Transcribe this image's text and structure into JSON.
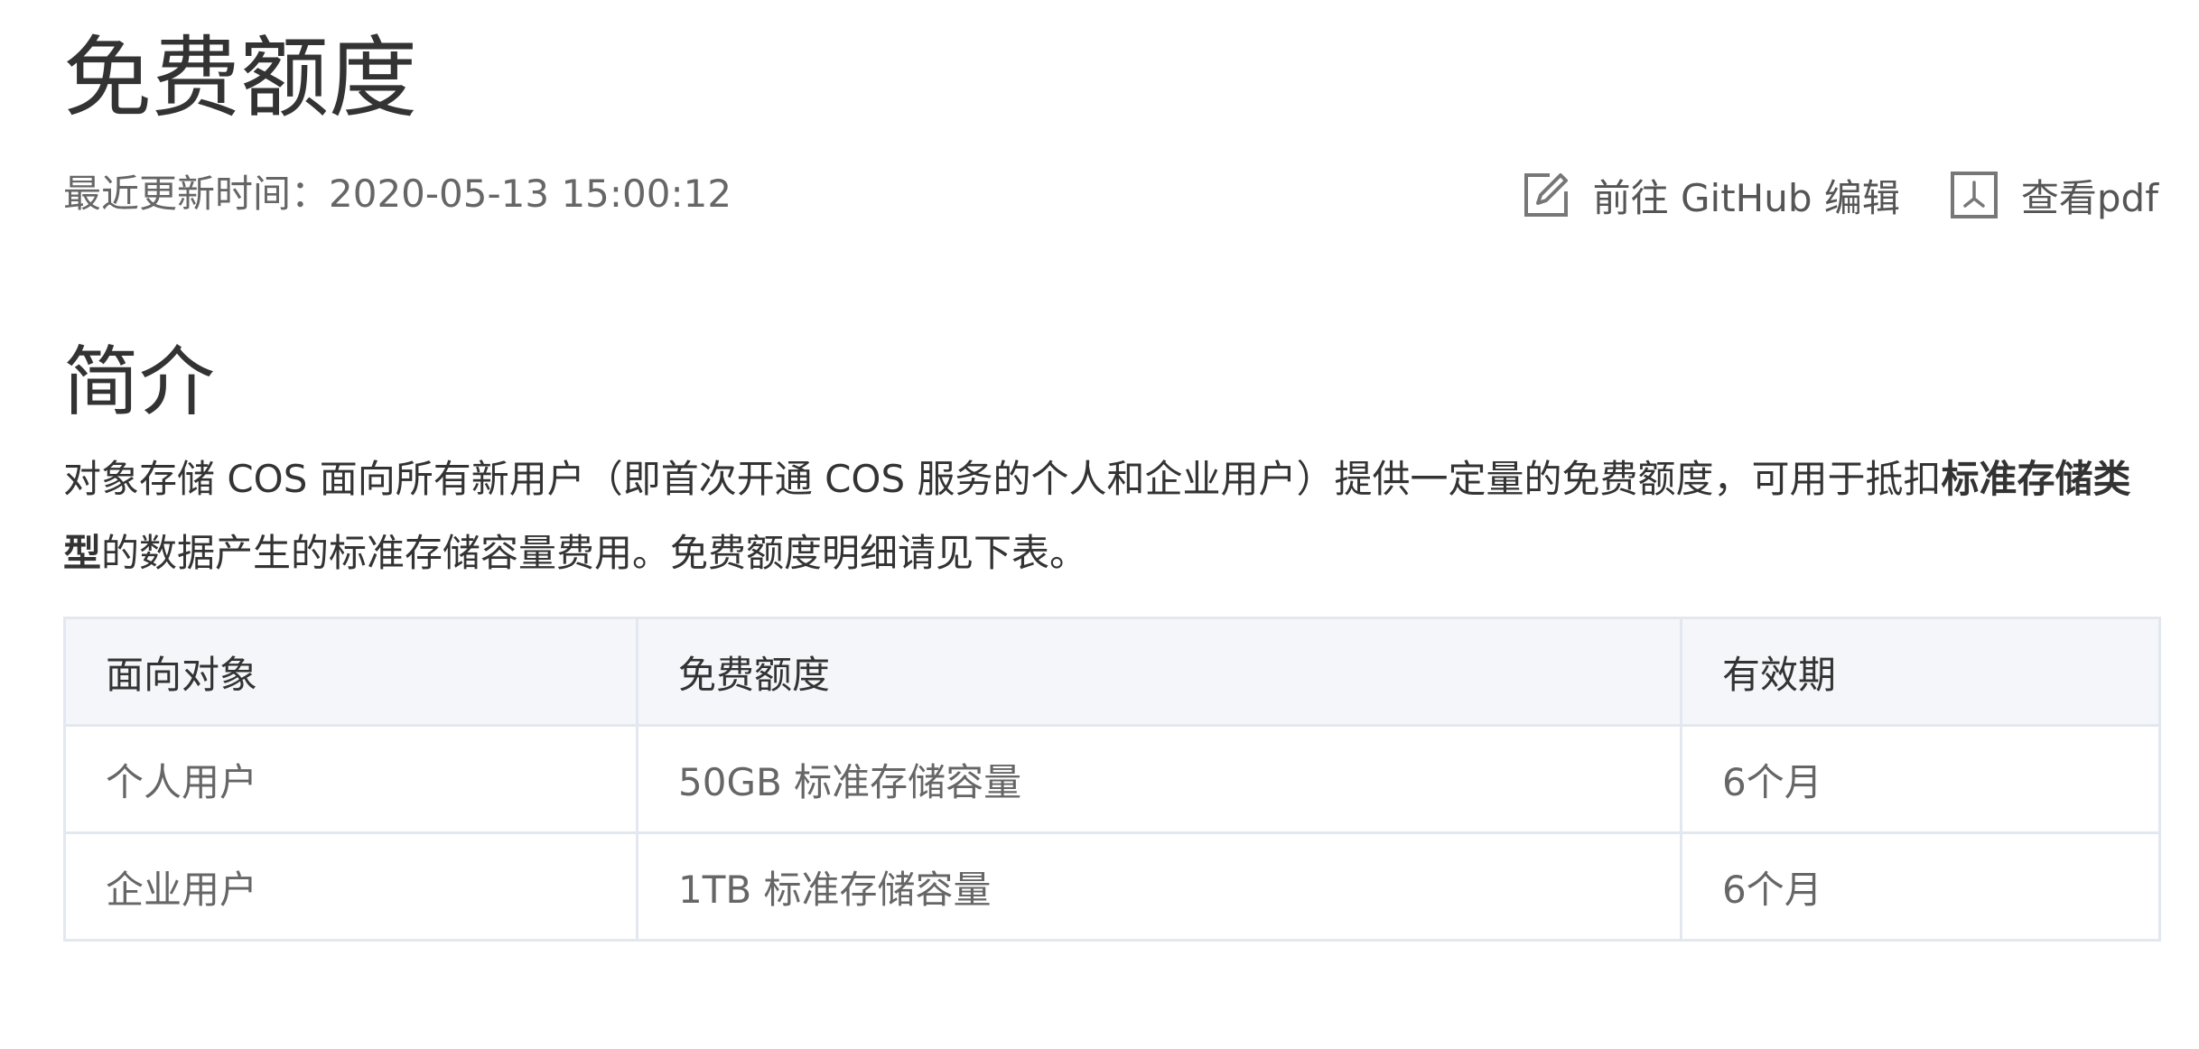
{
  "title": "免费额度",
  "meta": {
    "updated_label": "最近更新时间：",
    "updated_value": "2020-05-13 15:00:12",
    "edit_label": "前往 GitHub 编辑",
    "pdf_label": "查看pdf",
    "edit_icon": "edit-icon",
    "pdf_icon": "pdf-icon"
  },
  "section": {
    "heading": "简介",
    "intro_before": "对象存储 COS 面向所有新用户（即首次开通 COS 服务的个人和企业用户）提供一定量的免费额度，可用于抵扣",
    "intro_bold": "标准存储类型",
    "intro_after": "的数据产生的标准存储容量费用。免费额度明细请见下表。"
  },
  "table": {
    "headers": [
      "面向对象",
      "免费额度",
      "有效期"
    ],
    "rows": [
      [
        "个人用户",
        "50GB 标准存储容量",
        "6个月"
      ],
      [
        "企业用户",
        "1TB 标准存储容量",
        "6个月"
      ]
    ]
  },
  "colors": {
    "text": "#333333",
    "muted": "#666666",
    "table_border": "#e3e8f0",
    "table_header_bg": "#f4f6fa"
  }
}
